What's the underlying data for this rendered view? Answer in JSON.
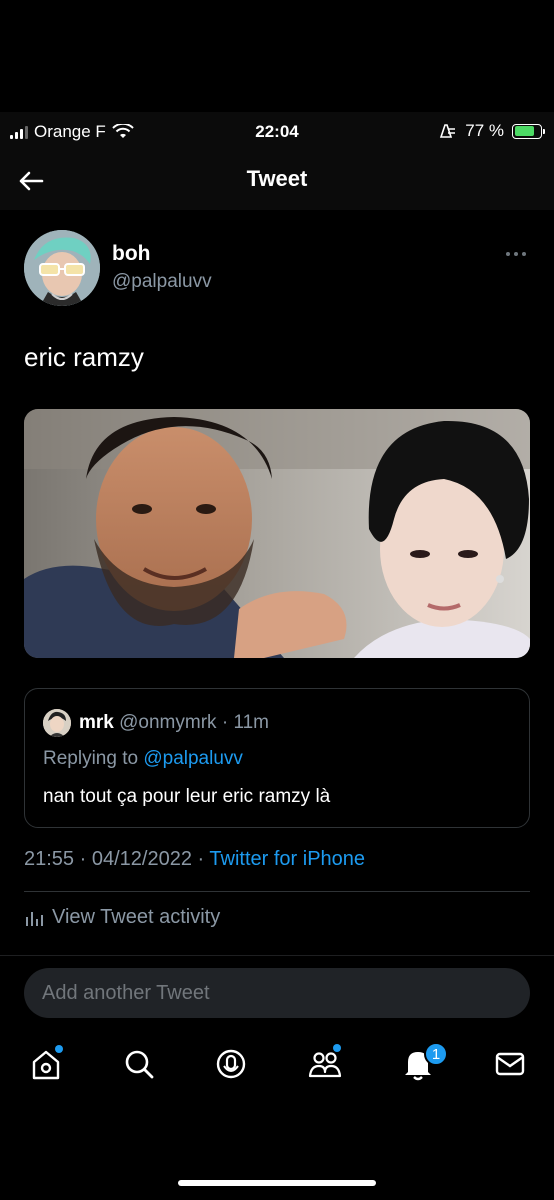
{
  "status_bar": {
    "carrier": "Orange F",
    "time": "22:04",
    "battery_percent_text": "77 %",
    "battery_level": 0.77
  },
  "header": {
    "title": "Tweet"
  },
  "tweet": {
    "author_name": "boh",
    "author_handle": "@palpaluvv",
    "text": "eric ramzy"
  },
  "reply": {
    "name": "mrk",
    "handle": "@onmymrk",
    "separator": "·",
    "age": "11m",
    "replying_prefix": "Replying to",
    "replying_to": "@palpaluvv",
    "text": "nan tout ça pour leur eric ramzy là"
  },
  "meta": {
    "time": "21:55",
    "separator": "·",
    "date": "04/12/2022",
    "source": "Twitter for iPhone"
  },
  "activity": {
    "label": "View Tweet activity"
  },
  "composer": {
    "placeholder": "Add another Tweet"
  },
  "tabbar": {
    "notifications_count": "1"
  },
  "colors": {
    "accent": "#1d9bf0",
    "background": "#000000",
    "muted": "#8b98a5"
  }
}
